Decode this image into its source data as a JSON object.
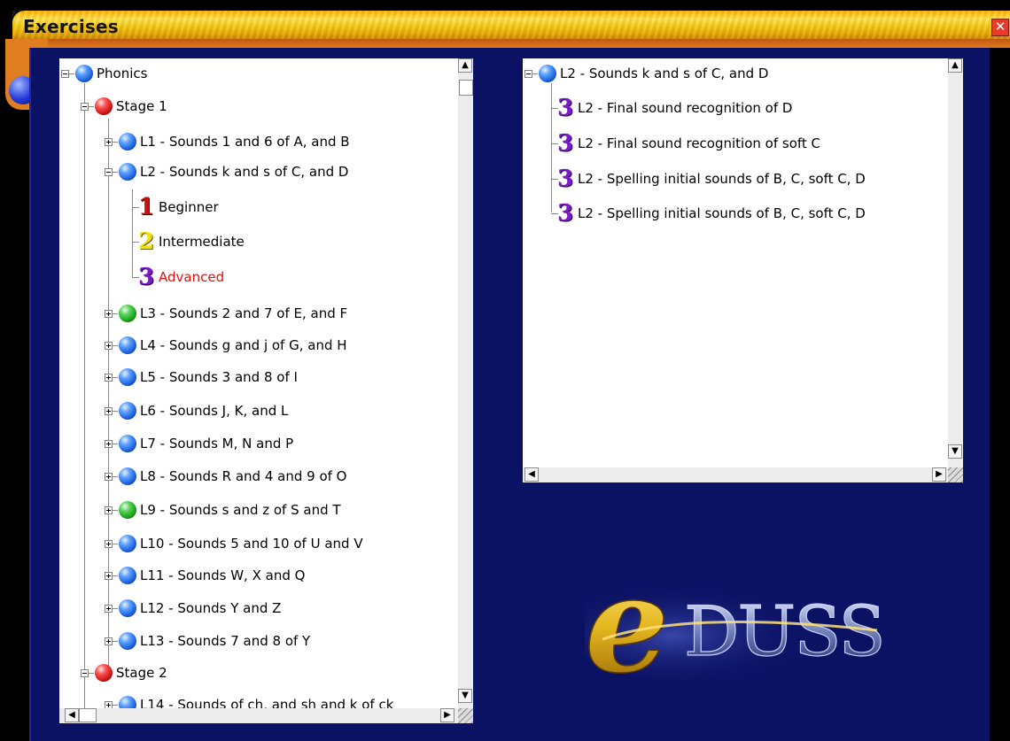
{
  "window": {
    "title": "Exercises",
    "close_label": "✕"
  },
  "left_tree": [
    {
      "label": "Phonics",
      "icon": "ball-blue",
      "expander": "minus"
    },
    {
      "label": "Stage 1",
      "icon": "ball-red",
      "expander": "minus"
    },
    {
      "label": "L1 - Sounds 1 and 6 of A, and B",
      "icon": "ball-blue",
      "expander": "plus"
    },
    {
      "label": "L2 - Sounds k and s of C, and D",
      "icon": "ball-blue",
      "expander": "minus"
    },
    {
      "label": "Beginner",
      "icon": "level-1",
      "numeral": "1"
    },
    {
      "label": "Intermediate",
      "icon": "level-2",
      "numeral": "2"
    },
    {
      "label": "Advanced",
      "icon": "level-3",
      "numeral": "3",
      "color": "#e01010",
      "selected": true
    },
    {
      "label": "L3 - Sounds 2 and 7 of E, and F",
      "icon": "ball-green",
      "expander": "plus"
    },
    {
      "label": "L4 - Sounds g and j of G, and H",
      "icon": "ball-blue",
      "expander": "plus"
    },
    {
      "label": "L5 - Sounds 3 and 8 of I",
      "icon": "ball-blue",
      "expander": "plus"
    },
    {
      "label": "L6 - Sounds J, K, and L",
      "icon": "ball-blue",
      "expander": "plus"
    },
    {
      "label": "L7 - Sounds M, N and P",
      "icon": "ball-blue",
      "expander": "plus"
    },
    {
      "label": "L8 - Sounds R and 4 and 9 of O",
      "icon": "ball-blue",
      "expander": "plus"
    },
    {
      "label": "L9 - Sounds s and z of S and T",
      "icon": "ball-green",
      "expander": "plus"
    },
    {
      "label": "L10 - Sounds 5 and 10 of U and V",
      "icon": "ball-blue",
      "expander": "plus"
    },
    {
      "label": "L11 - Sounds W, X and Q",
      "icon": "ball-blue",
      "expander": "plus"
    },
    {
      "label": "L12 - Sounds Y and Z",
      "icon": "ball-blue",
      "expander": "plus"
    },
    {
      "label": "L13 - Sounds 7 and 8 of Y",
      "icon": "ball-blue",
      "expander": "plus"
    },
    {
      "label": "Stage 2",
      "icon": "ball-red",
      "expander": "minus"
    },
    {
      "label": "L14 - Sounds of ch, and sh and k of ck",
      "icon": "ball-blue",
      "expander": "plus"
    }
  ],
  "right_tree": [
    {
      "label": "L2 - Sounds k and s of C, and D",
      "icon": "ball-blue",
      "expander": "minus"
    },
    {
      "label": "L2 - Final sound recognition of D",
      "numeral": "3"
    },
    {
      "label": "L2 - Final sound recognition of soft C",
      "numeral": "3"
    },
    {
      "label": "L2 - Spelling initial sounds of B, C, soft C, D",
      "numeral": "3"
    },
    {
      "label": "L2 - Spelling initial sounds of B, C, soft C, D",
      "numeral": "3"
    }
  ],
  "scroll": {
    "up": "▲",
    "down": "▼",
    "left": "◀",
    "right": "▶"
  },
  "logo": {
    "letter": "e",
    "text": "DUSS"
  },
  "colors": {
    "panel_bg": "#0b1163",
    "title_bar": "#f5c814",
    "selected_text": "#e01010"
  }
}
